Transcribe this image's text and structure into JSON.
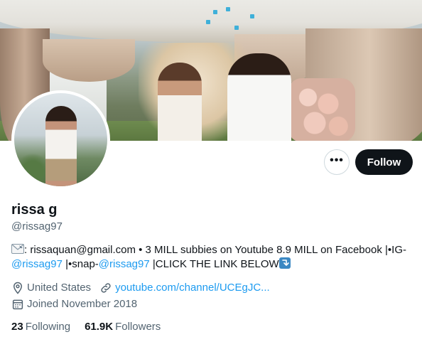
{
  "profile": {
    "display_name": "rissa g",
    "handle": "@rissag97",
    "bio_parts": {
      "email_prefix": ": rissaquan@gmail.com • 3 MILL subbies on Youtube 8.9 MILL on Facebook |•IG-",
      "ig_handle": "@rissag97",
      "snap_prefix": " |•snap-",
      "snap_handle": "@rissag97",
      "cta": " |CLICK THE LINK BELOW"
    },
    "location": "United States",
    "website": "youtube.com/channel/UCEgJC...",
    "joined": "Joined November 2018"
  },
  "actions": {
    "more_label": "•••",
    "follow_label": "Follow"
  },
  "stats": {
    "following_count": "23",
    "following_label": "Following",
    "followers_count": "61.9K",
    "followers_label": "Followers"
  },
  "icons": {
    "bio_lead": "envelope-icon",
    "bio_end": "down-arrow-icon",
    "location": "location-pin-icon",
    "website": "link-icon",
    "joined": "calendar-icon"
  },
  "colors": {
    "link": "#1d9bf0",
    "follow_bg": "#0f1419",
    "muted": "#536471"
  }
}
